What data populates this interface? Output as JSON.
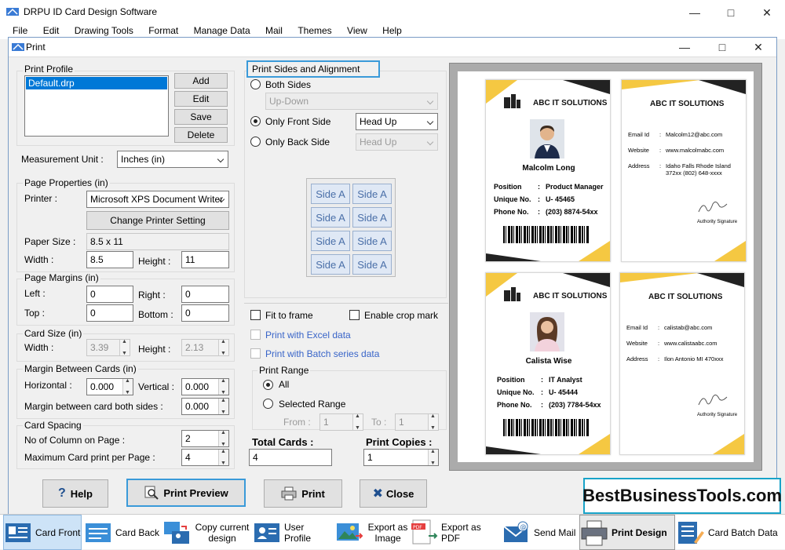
{
  "app": {
    "title": "DRPU ID Card Design Software"
  },
  "menu": [
    "File",
    "Edit",
    "Drawing Tools",
    "Format",
    "Manage Data",
    "Mail",
    "Themes",
    "View",
    "Help"
  ],
  "dialog": {
    "title": "Print"
  },
  "print_profile": {
    "label": "Print Profile",
    "items": [
      "Default.drp"
    ],
    "selected": "Default.drp",
    "add": "Add",
    "edit": "Edit",
    "save": "Save",
    "delete": "Delete"
  },
  "measurement": {
    "label": "Measurement Unit :",
    "value": "Inches (in)"
  },
  "page_properties": {
    "label": "Page Properties (in)",
    "printer_label": "Printer :",
    "printer_value": "Microsoft XPS Document Writer",
    "change_printer": "Change Printer Setting",
    "paper_size_label": "Paper Size :",
    "paper_size_value": "8.5 x 11",
    "width_label": "Width :",
    "width_value": "8.5",
    "height_label": "Height :",
    "height_value": "11"
  },
  "page_margins": {
    "label": "Page Margins (in)",
    "left_label": "Left :",
    "left_value": "0",
    "right_label": "Right :",
    "right_value": "0",
    "top_label": "Top :",
    "top_value": "0",
    "bottom_label": "Bottom :",
    "bottom_value": "0"
  },
  "card_size": {
    "label": "Card Size (in)",
    "width_label": "Width :",
    "width_value": "3.39",
    "height_label": "Height :",
    "height_value": "2.13"
  },
  "margin_between": {
    "label": "Margin Between Cards (in)",
    "horizontal_label": "Horizontal :",
    "horizontal_value": "0.000",
    "vertical_label": "Vertical :",
    "vertical_value": "0.000",
    "both_label": "Margin between card both sides :",
    "both_value": "0.000"
  },
  "card_spacing": {
    "label": "Card Spacing",
    "columns_label": "No of Column on Page :",
    "columns_value": "2",
    "max_label": "Maximum Card print per Page :",
    "max_value": "4"
  },
  "print_sides": {
    "label": "Print Sides and Alignment",
    "both_sides": "Both Sides",
    "both_select": "Up-Down",
    "front_only": "Only Front Side",
    "front_select": "Head Up",
    "back_only": "Only Back Side",
    "back_select": "Head Up",
    "side_buttons": [
      "Side A",
      "Side A",
      "Side A",
      "Side A",
      "Side A",
      "Side A",
      "Side A",
      "Side A"
    ]
  },
  "options": {
    "fit_to_frame": "Fit to frame",
    "crop_mark": "Enable crop mark",
    "excel": "Print with Excel data",
    "batch": "Print with Batch series data"
  },
  "print_range": {
    "label": "Print Range",
    "all": "All",
    "selected": "Selected Range",
    "from_label": "From :",
    "from_value": "1",
    "to_label": "To :",
    "to_value": "1"
  },
  "totals": {
    "total_label": "Total Cards :",
    "total_value": "4",
    "copies_label": "Print Copies :",
    "copies_value": "1"
  },
  "cards": [
    {
      "company": "ABC IT SOLUTIONS",
      "name": "Malcolm Long",
      "position_label": "Position",
      "position": "Product Manager",
      "unique_label": "Unique No.",
      "unique": "U- 45465",
      "phone_label": "Phone No.",
      "phone": "(203) 8874-54xx",
      "email_label": "Email Id",
      "email": "Malcolm12@abc.com",
      "website_label": "Website",
      "website": "www.malcolmabc.com",
      "address_label": "Address",
      "address": "Idaho Falls Rhode Island 372xx (802) 648-xxxx",
      "authority": "Authority Signature"
    },
    {
      "company": "ABC IT SOLUTIONS",
      "name": "Calista Wise",
      "position_label": "Position",
      "position": "IT Analyst",
      "unique_label": "Unique No.",
      "unique": "U- 45444",
      "phone_label": "Phone No.",
      "phone": "(203) 7784-54xx",
      "email_label": "Email Id",
      "email": "calistab@abc.com",
      "website_label": "Website",
      "website": "www.calistaabc.com",
      "address_label": "Address",
      "address": "Ilon Antonio MI 470xxx",
      "authority": "Authority Signature"
    }
  ],
  "buttons": {
    "help": "Help",
    "print_preview": "Print Preview",
    "print": "Print",
    "close": "Close"
  },
  "brand": "BestBusinessTools.com",
  "taskbar": [
    {
      "label": "Card Front",
      "icon": "card-front-icon"
    },
    {
      "label": "Card Back",
      "icon": "card-back-icon"
    },
    {
      "label": "Copy current design",
      "icon": "copy-design-icon"
    },
    {
      "label": "User Profile",
      "icon": "user-profile-icon"
    },
    {
      "label": "Export as Image",
      "icon": "export-image-icon"
    },
    {
      "label": "Export as PDF",
      "icon": "export-pdf-icon"
    },
    {
      "label": "Send Mail",
      "icon": "send-mail-icon"
    },
    {
      "label": "Print Design",
      "icon": "printer-icon"
    },
    {
      "label": "Card Batch Data",
      "icon": "card-batch-icon"
    }
  ],
  "colors": {
    "accent_yellow": "#f5c842",
    "brand_border": "#18a3c8",
    "selection": "#0078d7"
  }
}
